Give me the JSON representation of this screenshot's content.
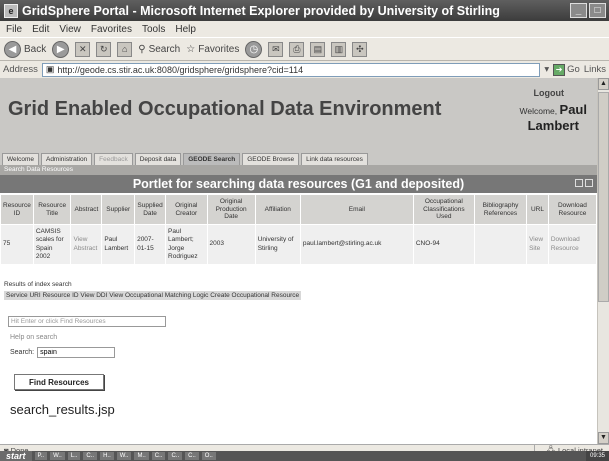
{
  "window": {
    "title": "GridSphere Portal - Microsoft Internet Explorer provided by University of Stirling"
  },
  "menu": [
    "File",
    "Edit",
    "View",
    "Favorites",
    "Tools",
    "Help"
  ],
  "toolbar": {
    "back_label": "Back",
    "search_label": "Search",
    "favorites_label": "Favorites"
  },
  "address": {
    "label": "Address",
    "url": "http://geode.cs.stir.ac.uk:8080/gridsphere/gridsphere?cid=114",
    "go_label": "Go",
    "links_label": "Links"
  },
  "banner": {
    "title": "Grid Enabled Occupational Data Environment",
    "logout": "Logout",
    "welcome": "Welcome,",
    "first_name": "Paul",
    "last_name": "Lambert"
  },
  "tabs": [
    "Welcome",
    "Administration",
    "Feedback",
    "Deposit data",
    "GEODE Search",
    "GEODE Browse",
    "Link data resources"
  ],
  "subtab": "Search Data Resources",
  "portlet": {
    "title": "Portlet for searching data resources (G1 and deposited)"
  },
  "table": {
    "headers": [
      "Resource ID",
      "Resource Title",
      "Abstract",
      "Supplier",
      "Supplied Date",
      "Original Creator",
      "Original Production Date",
      "Affiliation",
      "Email",
      "Occupational Classifications Used",
      "Bibliography References",
      "URL",
      "Download Resource"
    ],
    "rows": [
      {
        "id": "75",
        "title": "CAMSIS scales for Spain 2002",
        "abstract": "View Abstract",
        "supplier": "Paul Lambert",
        "supplied_date": "2007-01-15",
        "creator": "Paul Lambert; Jorge Rodriguez",
        "production_date": "2003",
        "affiliation": "University of Stirling",
        "email": "paul.lambert@stirling.ac.uk",
        "classifications": "CNO-94",
        "bibliography": "",
        "url": "View Site",
        "download": "Download Resource"
      }
    ]
  },
  "results": {
    "label": "Results of index search",
    "service_line": "Service URI Resource ID View DDI View Occupational Matching Logic Create Occupational Resource"
  },
  "search": {
    "hint": "Hit Enter or click Find Resources",
    "help": "Help on search",
    "label": "Search:",
    "value": "spain",
    "button": "Find Resources"
  },
  "footer_text": "search_results.jsp",
  "status": {
    "left": "Done",
    "zone": "Local intranet"
  },
  "taskbar": {
    "start": "start",
    "tasks": [
      "P..",
      "W..",
      "L..",
      "C..",
      "H..",
      "W..",
      "M..",
      "C..",
      "C..",
      "C..",
      "O.."
    ],
    "clock": "09:35"
  }
}
